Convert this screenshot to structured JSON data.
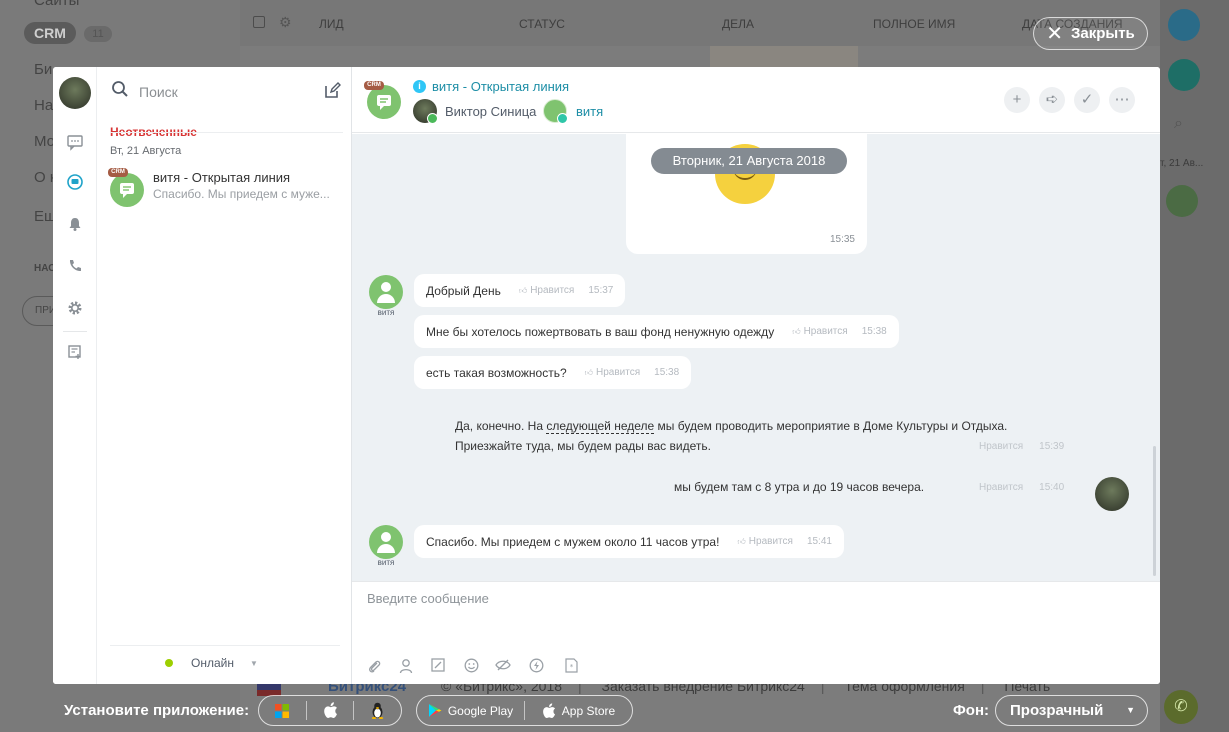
{
  "background": {
    "left_items": [
      "Сайты",
      "Би",
      "На",
      "Мо",
      "О к",
      "Ещ"
    ],
    "crm_label": "CRM",
    "crm_count": "11",
    "section_small": "НАС",
    "button_small": "ПРИ",
    "table_headers": [
      "ЛИД",
      "СТАТУС",
      "ДЕЛА",
      "ПОЛНОЕ ИМЯ",
      "ДАТА СОЗДАНИЯ"
    ],
    "right_time": "т, 21 Ав...",
    "footer": {
      "logo": "Битрикс24",
      "copyright": "© «Битрикс», 2018",
      "order": "Заказать внедрение Битрикс24",
      "theme": "Тема оформления",
      "print": "Печать"
    }
  },
  "close_button": {
    "label": "Закрыть"
  },
  "recent": {
    "search_placeholder": "Поиск",
    "section_title": "Неотвеченные",
    "date_label": "Вт, 21 Августа",
    "items": [
      {
        "tag": "CRM",
        "title": "витя - Открытая линия",
        "preview": "Спасибо. Мы приедем с муже..."
      }
    ],
    "status": "Онлайн"
  },
  "chat": {
    "header": {
      "tag": "CRM",
      "title": "витя - Открытая линия",
      "operator_name": "Виктор Синица",
      "client_name": "витя"
    },
    "date_pill": "Вторник, 21 Августа 2018",
    "sys_time": "15:35",
    "like_label": "Нравится",
    "incoming_author": "витя",
    "messages_in_1": [
      {
        "text": "Добрый День",
        "time": "15:37"
      },
      {
        "text": "Мне бы хотелось пожертвовать в ваш фонд ненужную одежду",
        "time": "15:38"
      },
      {
        "text": "есть такая возможность?",
        "time": "15:38"
      }
    ],
    "messages_out": {
      "m1_part1": "Да, конечно. На ",
      "m1_link": "следующей неделе",
      "m1_part2": " мы будем проводить мероприятие в Доме Культуры и Отдыха.",
      "m1_line2": "Приезжайте туда, мы будем рады вас видеть.",
      "m1_time": "15:39",
      "m2_text": "мы будем там с 8 утра и  до 19 часов вечера.",
      "m2_time": "15:40"
    },
    "messages_in_2": [
      {
        "text": "Спасибо. Мы приедем с мужем около 11 часов утра!",
        "time": "15:41"
      }
    ],
    "composer_placeholder": "Введите сообщение"
  },
  "appbar": {
    "install_label": "Установите приложение:",
    "google_play": "Google Play",
    "app_store": "App Store",
    "bg_label": "Фон:",
    "bg_value": "Прозрачный"
  }
}
